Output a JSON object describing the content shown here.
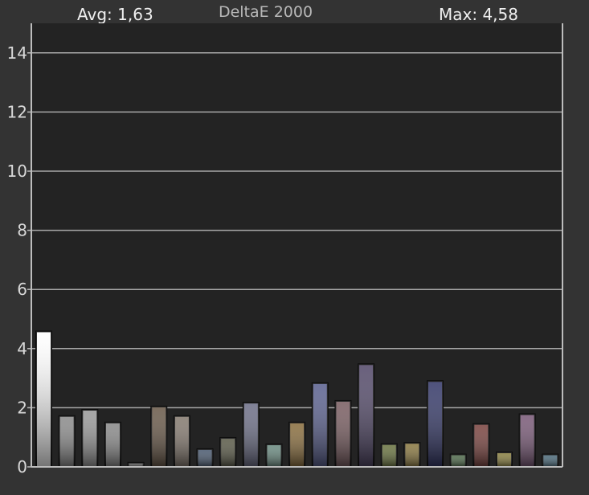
{
  "header": {
    "avg_text": "Avg: 1,63",
    "title": "DeltaE 2000",
    "max_text": "Max: 4,58"
  },
  "chart_data": {
    "type": "bar",
    "title": "DeltaE 2000",
    "xlabel": "",
    "ylabel": "",
    "ylim": [
      0,
      15
    ],
    "yticks": [
      0,
      2,
      4,
      6,
      8,
      10,
      12,
      14
    ],
    "ytick_labels": [
      "0",
      "2",
      "4",
      "6",
      "8",
      "10",
      "12",
      "14"
    ],
    "grid": true,
    "values": [
      4.58,
      1.72,
      1.93,
      1.5,
      0.14,
      2.04,
      1.72,
      0.6,
      0.98,
      2.17,
      0.76,
      1.5,
      2.83,
      2.23,
      3.47,
      0.77,
      0.81,
      2.9,
      0.42,
      1.45,
      0.49,
      1.78,
      0.42
    ],
    "colors": [
      "#ffffff",
      "#8c8c8c",
      "#9a9a9a",
      "#8a8a8a",
      "#5a5a5a",
      "#6a5a4a",
      "#857a70",
      "#4a5a70",
      "#5a5a48",
      "#6e7088",
      "#6a8a80",
      "#8a6e3e",
      "#5c6290",
      "#7a5e62",
      "#544a6a",
      "#6a7440",
      "#8a7840",
      "#363a6a",
      "#4e6a4a",
      "#7a4440",
      "#8a8040",
      "#7a5a78",
      "#4a6a7a"
    ]
  }
}
